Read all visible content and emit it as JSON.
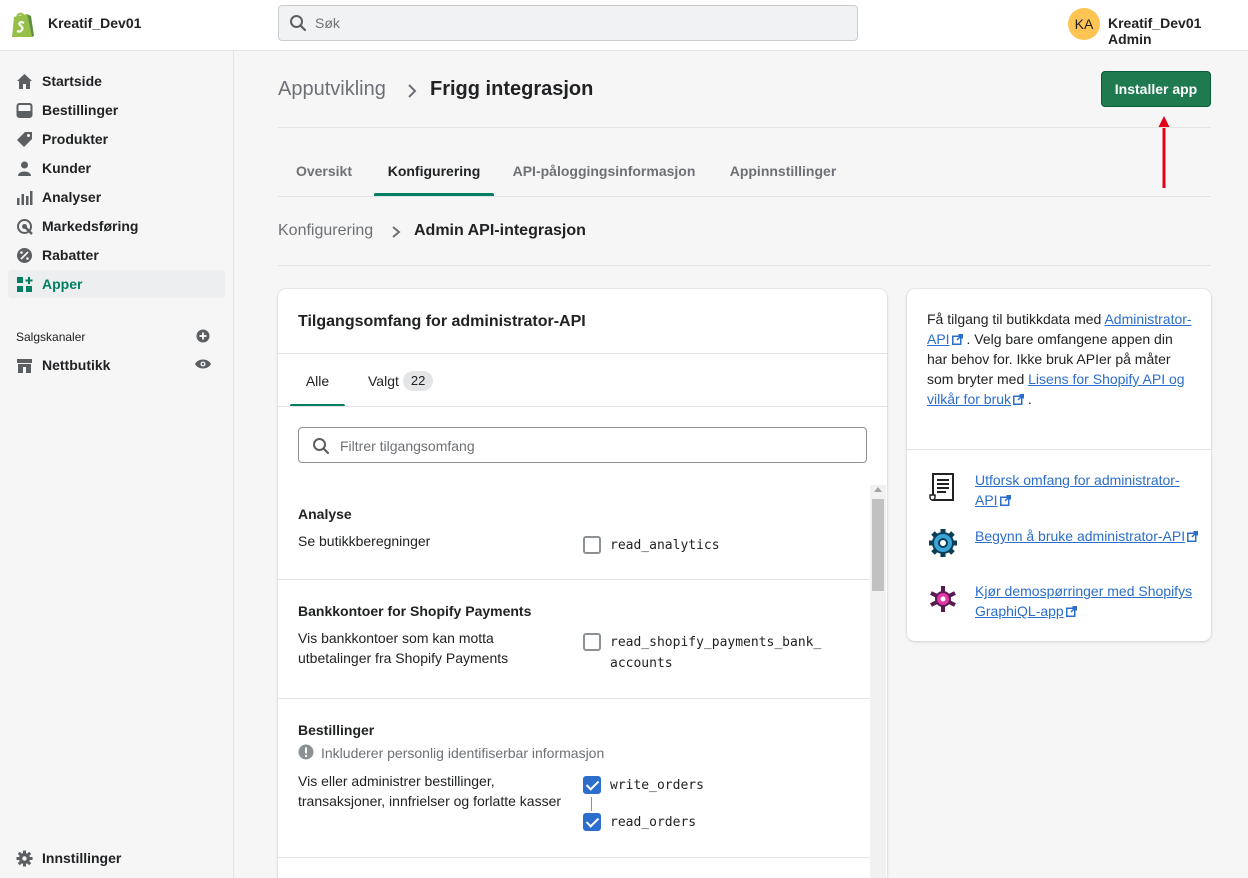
{
  "topbar": {
    "store_name": "Kreatif_Dev01",
    "search_placeholder": "Søk",
    "avatar_initials": "KA",
    "user_name": "Kreatif_Dev01 Admin"
  },
  "sidebar": {
    "items": [
      {
        "label": "Startside",
        "icon": "home-icon"
      },
      {
        "label": "Bestillinger",
        "icon": "orders-icon"
      },
      {
        "label": "Produkter",
        "icon": "tag-icon"
      },
      {
        "label": "Kunder",
        "icon": "person-icon"
      },
      {
        "label": "Analyser",
        "icon": "bar-chart-icon"
      },
      {
        "label": "Markedsføring",
        "icon": "target-icon"
      },
      {
        "label": "Rabatter",
        "icon": "discount-icon"
      },
      {
        "label": "Apper",
        "icon": "apps-icon",
        "active": true
      }
    ],
    "sales_channels_label": "Salgskanaler",
    "channel_label": "Nettbutikk",
    "settings_label": "Innstillinger"
  },
  "header": {
    "breadcrumb_parent": "Apputvikling",
    "title": "Frigg integrasjon",
    "install_button": "Installer app"
  },
  "tabs": [
    {
      "label": "Oversikt"
    },
    {
      "label": "Konfigurering",
      "active": true
    },
    {
      "label": "API-påloggingsinformasjon"
    },
    {
      "label": "Appinnstillinger"
    }
  ],
  "sub_breadcrumb": {
    "parent": "Konfigurering",
    "current": "Admin API-integrasjon"
  },
  "scopes_card": {
    "title": "Tilgangsomfang for administrator-API",
    "tab_all": "Alle",
    "tab_selected": "Valgt",
    "selected_count": "22",
    "filter_placeholder": "Filtrer tilgangsomfang",
    "sections": [
      {
        "title": "Analyse",
        "description": "Se butikkberegninger",
        "scopes": [
          {
            "name": "read_analytics",
            "checked": false
          }
        ]
      },
      {
        "title": "Bankkontoer for Shopify Payments",
        "description": "Vis bankkontoer som kan motta utbetalinger fra Shopify Payments",
        "scopes": [
          {
            "name": "read_shopify_payments_bank_",
            "name_cont": "accounts",
            "checked": false
          }
        ]
      },
      {
        "title": "Bestillinger",
        "warning": "Inkluderer personlig identifiserbar informasjon",
        "description": "Vis eller administrer bestillinger, transaksjoner, innfrielser og forlatte kasser",
        "scopes": [
          {
            "name": "write_orders",
            "checked": true
          },
          {
            "name": "read_orders",
            "checked": true
          }
        ]
      }
    ]
  },
  "info_card": {
    "text_1": "Få tilgang til butikkdata med",
    "link_admin_api": "Administrator-API",
    "text_2": ". Velg bare omfangene appen din har behov for. Ikke bruk APIer på måter som bryter med",
    "link_license": "Lisens for Shopify API og vilkår for bruk",
    "text_3": ".",
    "resources": [
      {
        "label": "Utforsk omfang for administrator-API",
        "icon": "document-icon"
      },
      {
        "label": "Begynn å bruke administrator-API",
        "icon": "gear-icon"
      },
      {
        "label": "Kjør demospørringer med Shopifys GraphiQL-app",
        "icon": "graphql-icon"
      }
    ]
  },
  "colors": {
    "accent_green": "#008060",
    "button_green": "#1f7a4f",
    "link_blue": "#2c6ecb",
    "arrow_red": "#e5001a"
  }
}
